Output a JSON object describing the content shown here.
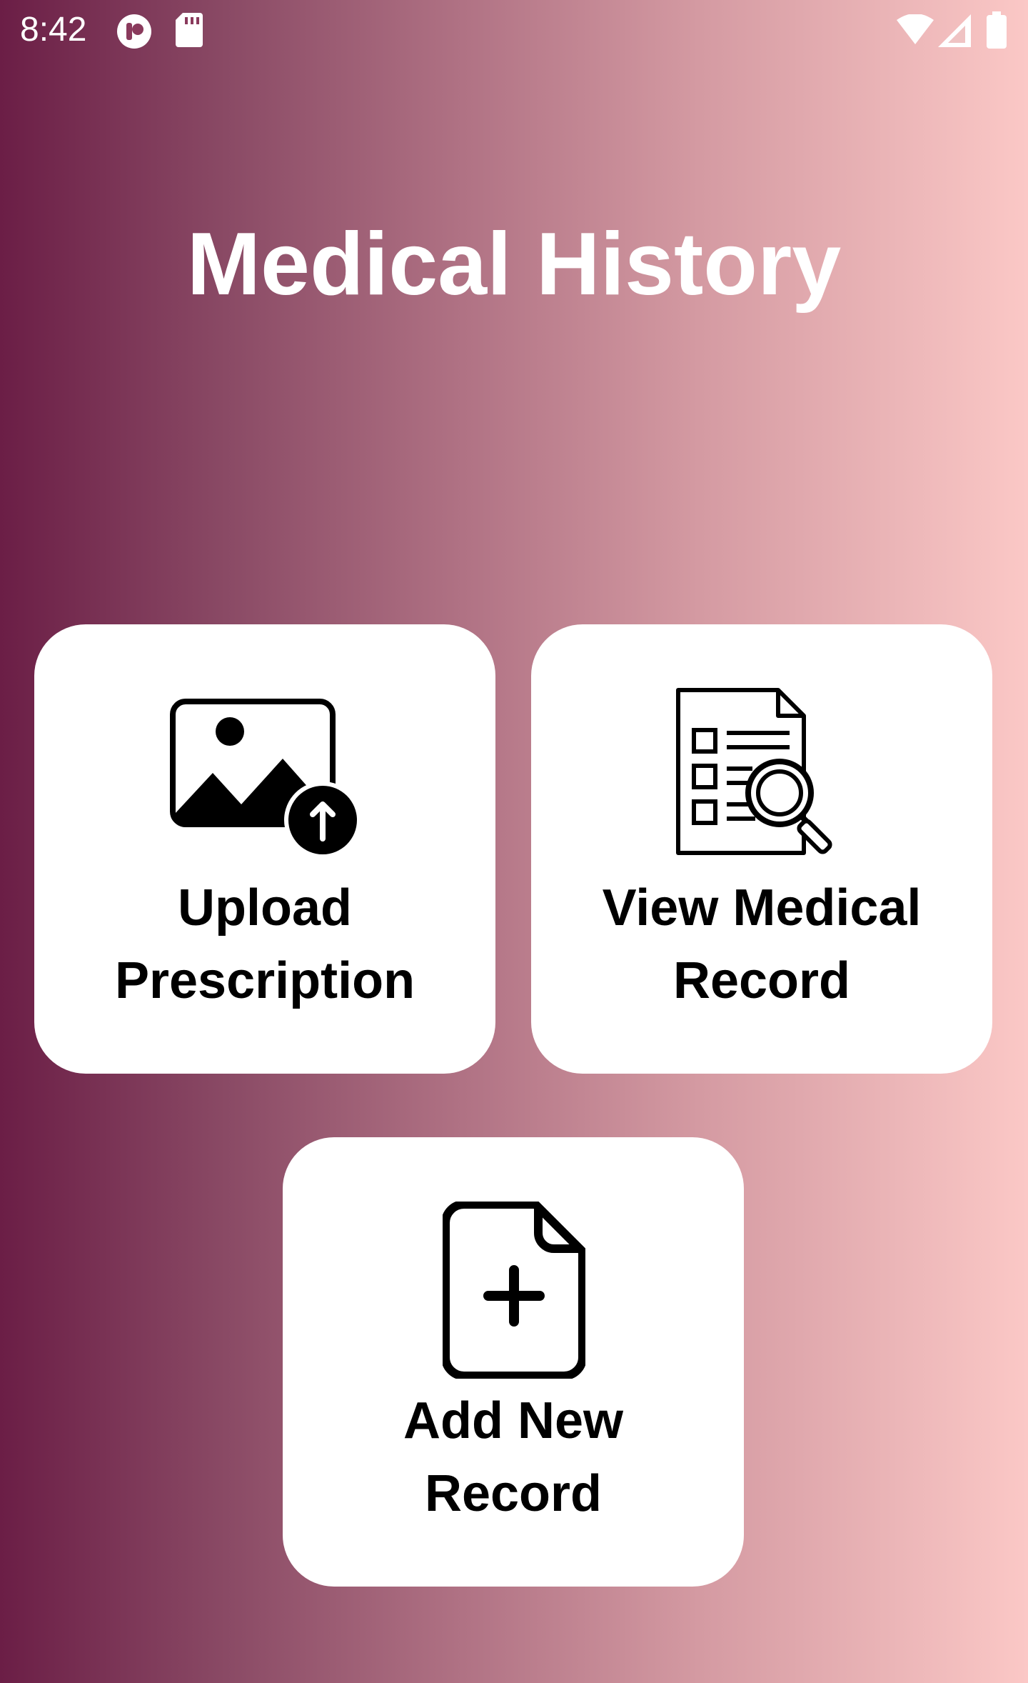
{
  "status_bar": {
    "time": "8:42",
    "icons": [
      "app-notification-icon",
      "sd-card-icon",
      "wifi-icon",
      "cell-signal-icon",
      "battery-icon"
    ]
  },
  "page": {
    "title": "Medical History"
  },
  "cards": {
    "upload": {
      "line1": "Upload",
      "line2": "Prescription",
      "icon": "image-upload-icon"
    },
    "view": {
      "line1": "View Medical",
      "line2": "Record",
      "icon": "document-search-icon"
    },
    "add": {
      "line1": "Add New",
      "line2": "Record",
      "icon": "add-file-icon"
    }
  },
  "colors": {
    "gradient_start": "#6b1e46",
    "gradient_end": "#fbc8c6",
    "card_background": "#ffffff",
    "text_primary": "#000000",
    "title_text": "#ffffff"
  }
}
